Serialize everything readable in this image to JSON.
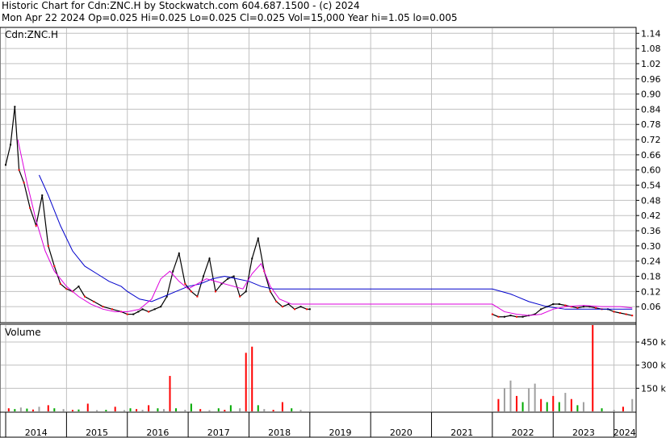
{
  "header": {
    "line1": "Historic Chart for Cdn:ZNC.H by Stockwatch.com 604.687.1500 - (c) 2024",
    "line2": "Mon Apr 22 2024  Op=0.025  Hi=0.025  Lo=0.025  Cl=0.025  Vol=15,000  Year hi=1.05  lo=0.005"
  },
  "colors": {
    "background": "#ffffff",
    "grid": "#c0c0c0",
    "price_up": "#000000",
    "price_down": "#ff0000",
    "ma_long": "#0000cc",
    "ma_short": "#dd00dd",
    "volume_up": "#00aa00",
    "volume_down": "#ff0000",
    "volume_flat": "#a0a0a0"
  },
  "chart_data": [
    {
      "type": "line",
      "title": "Cdn:ZNC.H",
      "ylim": [
        0.0,
        1.16
      ],
      "y_ticks": [
        "1.14",
        "1.08",
        "1.02",
        "0.96",
        "0.90",
        "0.84",
        "0.78",
        "0.72",
        "0.66",
        "0.60",
        "0.54",
        "0.48",
        "0.42",
        "0.36",
        "0.30",
        "0.24",
        "0.18",
        "0.12",
        "0.06"
      ],
      "x_ticks": [
        "2014",
        "2015",
        "2016",
        "2017",
        "2018",
        "2019",
        "2020",
        "2021",
        "2022",
        "2023",
        "2024"
      ],
      "x_tick_dates": [
        2014.0,
        2015.0,
        2016.0,
        2017.0,
        2018.0,
        2019.0,
        2020.0,
        2021.0,
        2022.0,
        2023.0,
        2024.0
      ],
      "xlim": [
        2013.92,
        2024.35
      ],
      "series": [
        {
          "name": "",
          "kind": "close",
          "x": [
            2014.0,
            2014.08,
            2014.15,
            2014.22,
            2014.3,
            2014.4,
            2014.5,
            2014.6,
            2014.7,
            2014.8,
            2014.9,
            2015.0,
            2015.1,
            2015.2,
            2015.3,
            2015.45,
            2015.6,
            2015.75,
            2015.9,
            2016.0,
            2016.1,
            2016.18,
            2016.25,
            2016.35,
            2016.45,
            2016.55,
            2016.65,
            2016.75,
            2016.85,
            2016.95,
            2017.05,
            2017.15,
            2017.25,
            2017.35,
            2017.45,
            2017.55,
            2017.65,
            2017.75,
            2017.85,
            2017.95,
            2018.05,
            2018.15,
            2018.25,
            2018.35,
            2018.45,
            2018.55,
            2018.65,
            2018.75,
            2018.85,
            2018.95,
            2019.0,
            2022.0,
            2022.1,
            2022.2,
            2022.3,
            2022.4,
            2022.5,
            2022.6,
            2022.7,
            2022.8,
            2022.9,
            2023.0,
            2023.1,
            2023.2,
            2023.3,
            2023.4,
            2023.5,
            2023.6,
            2023.7,
            2023.8,
            2023.9,
            2024.0,
            2024.1,
            2024.2,
            2024.3
          ],
          "y": [
            0.62,
            0.7,
            0.85,
            0.6,
            0.55,
            0.45,
            0.38,
            0.5,
            0.3,
            0.22,
            0.15,
            0.13,
            0.12,
            0.14,
            0.1,
            0.08,
            0.06,
            0.05,
            0.04,
            0.03,
            0.03,
            0.04,
            0.05,
            0.04,
            0.05,
            0.06,
            0.1,
            0.2,
            0.27,
            0.15,
            0.12,
            0.1,
            0.18,
            0.25,
            0.12,
            0.15,
            0.17,
            0.18,
            0.1,
            0.12,
            0.25,
            0.33,
            0.2,
            0.12,
            0.08,
            0.06,
            0.07,
            0.05,
            0.06,
            0.05,
            0.05,
            0.03,
            0.02,
            0.02,
            0.025,
            0.02,
            0.02,
            0.025,
            0.03,
            0.05,
            0.06,
            0.07,
            0.07,
            0.065,
            0.06,
            0.055,
            0.06,
            0.06,
            0.055,
            0.05,
            0.05,
            0.04,
            0.035,
            0.03,
            0.025
          ]
        },
        {
          "name": "",
          "kind": "moving_average_long",
          "x": [
            2014.55,
            2014.7,
            2014.9,
            2015.1,
            2015.3,
            2015.5,
            2015.7,
            2015.9,
            2016.0,
            2016.2,
            2016.4,
            2016.6,
            2016.8,
            2017.0,
            2017.2,
            2017.4,
            2017.6,
            2017.8,
            2018.0,
            2018.2,
            2018.4,
            2018.6,
            2018.8,
            2019.0,
            2020.0,
            2021.0,
            2022.0,
            2022.3,
            2022.6,
            2022.9,
            2023.2,
            2023.5,
            2023.8,
            2024.1,
            2024.3
          ],
          "y": [
            0.58,
            0.5,
            0.38,
            0.28,
            0.22,
            0.19,
            0.16,
            0.14,
            0.12,
            0.09,
            0.08,
            0.1,
            0.12,
            0.14,
            0.15,
            0.17,
            0.18,
            0.17,
            0.16,
            0.14,
            0.13,
            0.13,
            0.13,
            0.13,
            0.13,
            0.13,
            0.13,
            0.11,
            0.08,
            0.06,
            0.05,
            0.05,
            0.05,
            0.05,
            0.05
          ]
        },
        {
          "name": "",
          "kind": "moving_average_short",
          "x": [
            2014.2,
            2014.35,
            2014.5,
            2014.65,
            2014.8,
            2015.0,
            2015.2,
            2015.4,
            2015.6,
            2015.8,
            2016.0,
            2016.2,
            2016.4,
            2016.55,
            2016.7,
            2016.85,
            2017.0,
            2017.15,
            2017.3,
            2017.45,
            2017.6,
            2017.75,
            2017.9,
            2018.05,
            2018.2,
            2018.35,
            2018.5,
            2018.7,
            2018.9,
            2019.0,
            2020.0,
            2021.0,
            2022.0,
            2022.2,
            2022.4,
            2022.6,
            2022.8,
            2023.0,
            2023.2,
            2023.5,
            2023.8,
            2024.1,
            2024.3
          ],
          "y": [
            0.72,
            0.55,
            0.4,
            0.28,
            0.2,
            0.14,
            0.1,
            0.07,
            0.05,
            0.04,
            0.04,
            0.05,
            0.09,
            0.17,
            0.2,
            0.16,
            0.13,
            0.15,
            0.17,
            0.16,
            0.15,
            0.14,
            0.13,
            0.19,
            0.23,
            0.14,
            0.09,
            0.07,
            0.07,
            0.07,
            0.07,
            0.07,
            0.07,
            0.04,
            0.03,
            0.025,
            0.03,
            0.05,
            0.06,
            0.065,
            0.06,
            0.06,
            0.055
          ]
        }
      ]
    },
    {
      "type": "bar",
      "title": "Volume",
      "ylim": [
        0,
        560000
      ],
      "y_ticks": [
        "450 k",
        "300 k",
        "150 k"
      ],
      "y_tick_values": [
        450000,
        300000,
        150000
      ],
      "series": [
        {
          "name": "",
          "x": [
            2014.05,
            2014.15,
            2014.25,
            2014.35,
            2014.45,
            2014.55,
            2014.7,
            2014.8,
            2014.95,
            2015.1,
            2015.2,
            2015.35,
            2015.5,
            2015.65,
            2015.8,
            2015.95,
            2016.05,
            2016.15,
            2016.25,
            2016.35,
            2016.5,
            2016.6,
            2016.7,
            2016.8,
            2016.95,
            2017.05,
            2017.2,
            2017.35,
            2017.5,
            2017.6,
            2017.7,
            2017.85,
            2017.95,
            2018.05,
            2018.15,
            2018.25,
            2018.4,
            2018.55,
            2018.7,
            2018.85,
            2022.1,
            2022.2,
            2022.3,
            2022.4,
            2022.5,
            2022.6,
            2022.7,
            2022.8,
            2022.9,
            2023.0,
            2023.1,
            2023.2,
            2023.3,
            2023.4,
            2023.5,
            2023.65,
            2023.8,
            2024.0,
            2024.15,
            2024.3
          ],
          "values": [
            20000,
            15000,
            25000,
            18000,
            12000,
            30000,
            40000,
            20000,
            15000,
            10000,
            12000,
            50000,
            8000,
            10000,
            30000,
            8000,
            20000,
            15000,
            10000,
            40000,
            20000,
            15000,
            230000,
            20000,
            10000,
            50000,
            15000,
            8000,
            20000,
            10000,
            40000,
            20000,
            380000,
            420000,
            40000,
            15000,
            10000,
            60000,
            20000,
            10000,
            80000,
            150000,
            200000,
            100000,
            60000,
            150000,
            180000,
            80000,
            60000,
            100000,
            60000,
            120000,
            80000,
            40000,
            60000,
            570000,
            20000,
            10000,
            30000,
            80000
          ],
          "colors": [
            "down",
            "up",
            "flat",
            "up",
            "down",
            "flat",
            "down",
            "up",
            "flat",
            "down",
            "up",
            "down",
            "flat",
            "up",
            "down",
            "flat",
            "up",
            "down",
            "flat",
            "down",
            "up",
            "flat",
            "down",
            "up",
            "flat",
            "up",
            "down",
            "flat",
            "up",
            "down",
            "up",
            "flat",
            "down",
            "down",
            "up",
            "flat",
            "down",
            "down",
            "up",
            "flat",
            "down",
            "flat",
            "flat",
            "down",
            "up",
            "flat",
            "flat",
            "down",
            "up",
            "down",
            "up",
            "flat",
            "down",
            "up",
            "flat",
            "down",
            "up",
            "flat",
            "down",
            "flat"
          ]
        }
      ]
    }
  ]
}
